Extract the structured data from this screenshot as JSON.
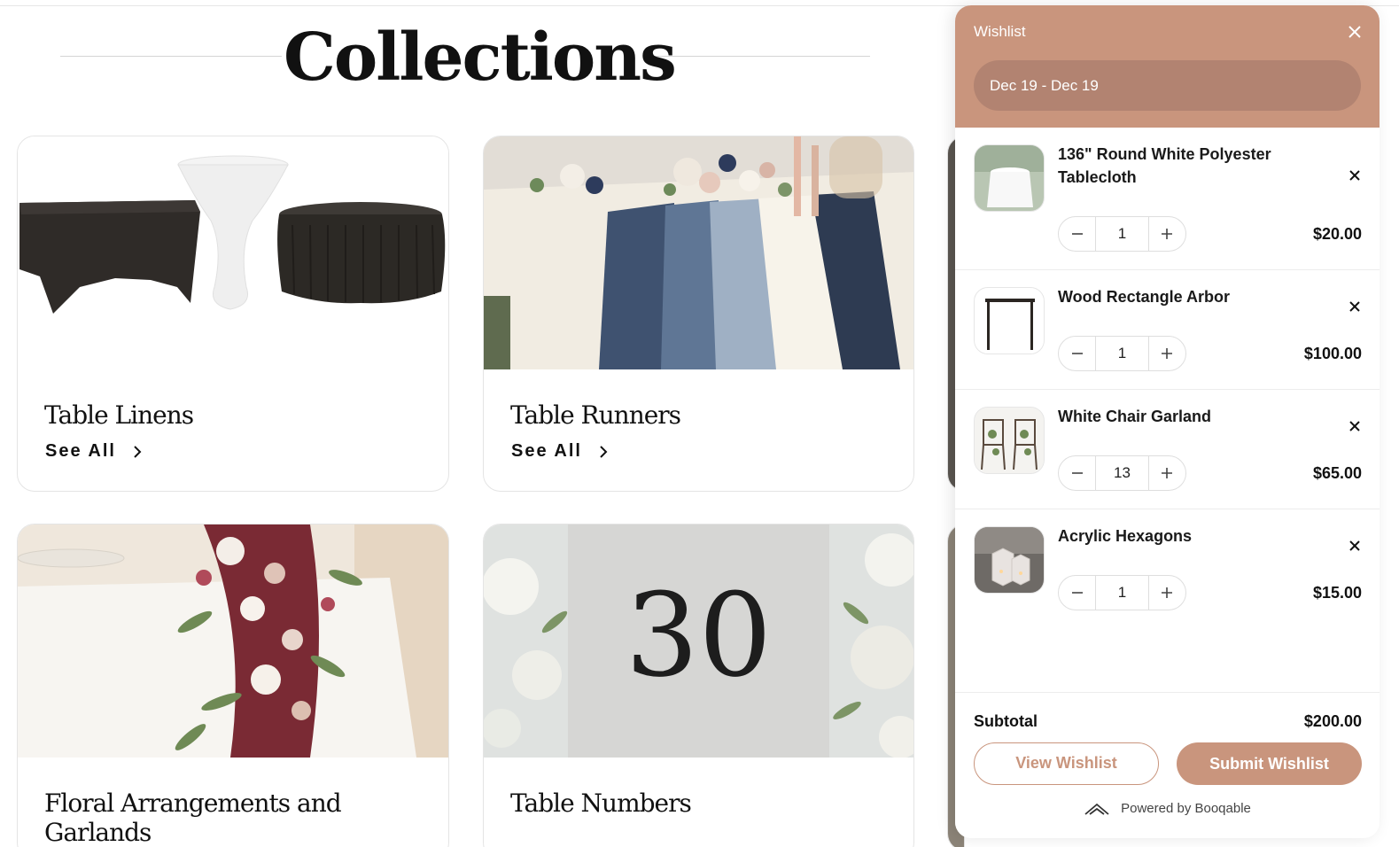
{
  "page": {
    "heading": "Collections"
  },
  "collections": [
    {
      "title": "Table Linens",
      "link": "See All"
    },
    {
      "title": "Table Runners",
      "link": "See All"
    },
    {
      "title": "Floral Arrangements and Garlands",
      "link": ""
    },
    {
      "title": "Table Numbers",
      "link": ""
    }
  ],
  "table_number_card": {
    "number": "30"
  },
  "wishlist": {
    "title": "Wishlist",
    "date_range": "Dec 19 - Dec 19",
    "items": [
      {
        "name": "136\" Round White Polyester Tablecloth",
        "qty": "1",
        "price": "$20.00",
        "icon": "tablecloth-thumbnail"
      },
      {
        "name": "Wood Rectangle Arbor",
        "qty": "1",
        "price": "$100.00",
        "icon": "arbor-thumbnail"
      },
      {
        "name": "White Chair Garland",
        "qty": "13",
        "price": "$65.00",
        "icon": "chair-garland-thumbnail"
      },
      {
        "name": "Acrylic Hexagons",
        "qty": "1",
        "price": "$15.00",
        "icon": "acrylic-hexagons-thumbnail"
      }
    ],
    "subtotal_label": "Subtotal",
    "subtotal_value": "$200.00",
    "view_button": "View Wishlist",
    "submit_button": "Submit Wishlist",
    "powered_by": "Powered by Booqable"
  },
  "colors": {
    "accent": "#c9957d",
    "accent_dark": "#b28371"
  }
}
